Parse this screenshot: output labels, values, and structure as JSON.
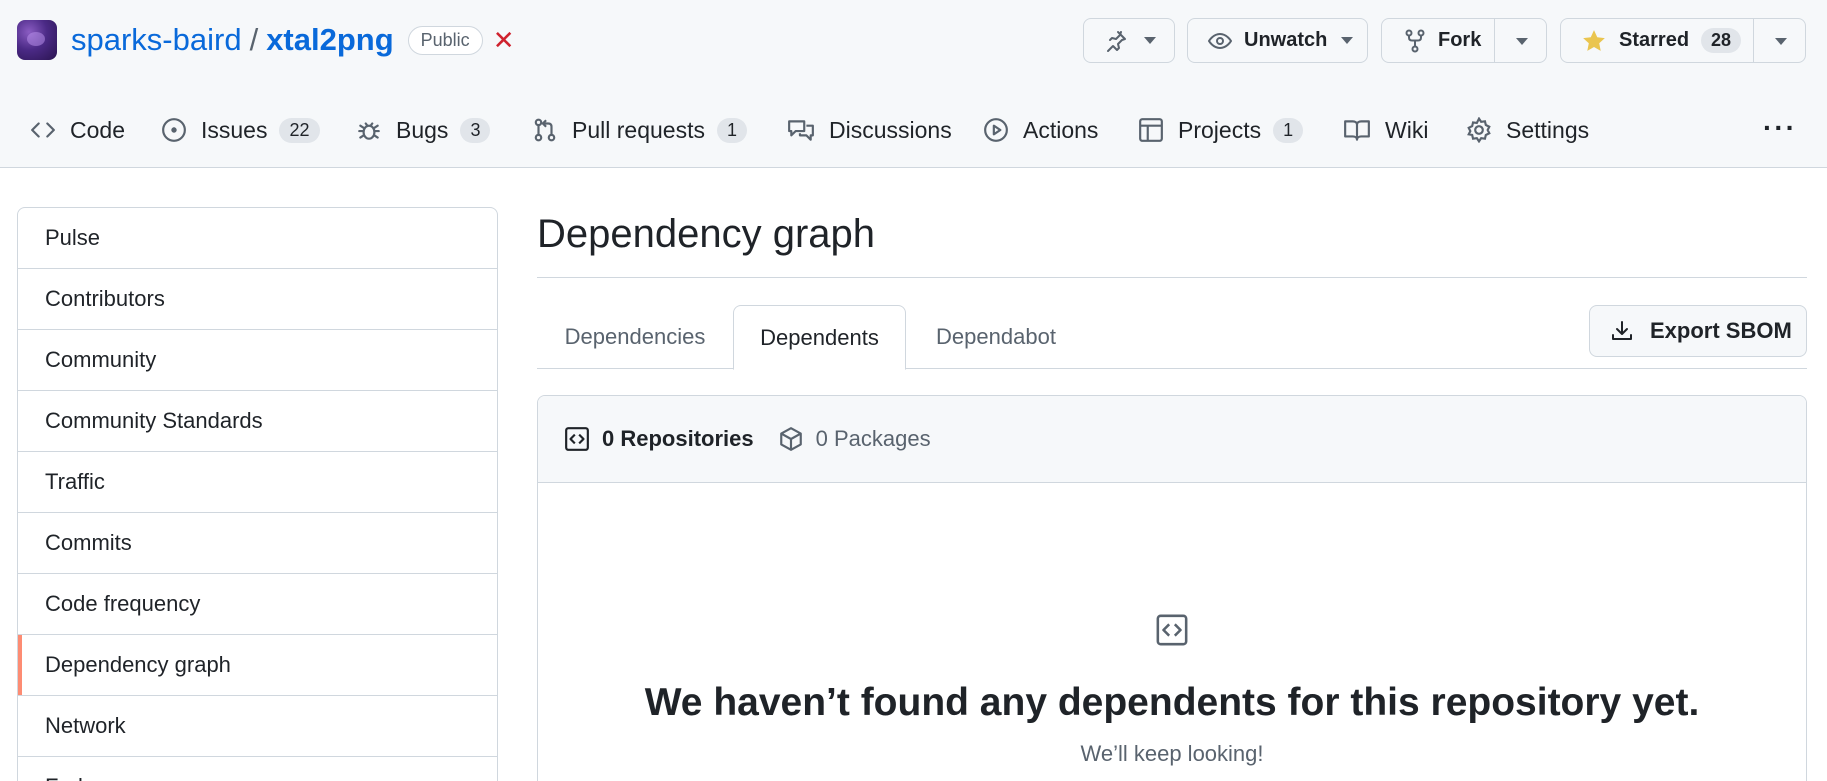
{
  "repo": {
    "owner": "sparks-baird",
    "separator": "/",
    "name": "xtal2png",
    "visibility": "Public",
    "status_mark": "✕"
  },
  "actions": {
    "pin_icon": "pin-icon",
    "watch_label": "Unwatch",
    "fork_label": "Fork",
    "star_label": "Starred",
    "star_count": "28"
  },
  "nav": {
    "items": [
      {
        "label": "Code",
        "icon": "code-icon"
      },
      {
        "label": "Issues",
        "icon": "issue-opened-icon",
        "count": "22"
      },
      {
        "label": "Bugs",
        "icon": "bug-icon",
        "count": "3"
      },
      {
        "label": "Pull requests",
        "icon": "git-pull-request-icon",
        "count": "1"
      },
      {
        "label": "Discussions",
        "icon": "comment-discussion-icon"
      },
      {
        "label": "Actions",
        "icon": "play-icon"
      },
      {
        "label": "Projects",
        "icon": "table-icon",
        "count": "1"
      },
      {
        "label": "Wiki",
        "icon": "book-icon"
      },
      {
        "label": "Settings",
        "icon": "gear-icon"
      }
    ],
    "more": "···"
  },
  "sidebar": {
    "items": [
      {
        "label": "Pulse"
      },
      {
        "label": "Contributors"
      },
      {
        "label": "Community"
      },
      {
        "label": "Community Standards"
      },
      {
        "label": "Traffic"
      },
      {
        "label": "Commits"
      },
      {
        "label": "Code frequency"
      },
      {
        "label": "Dependency graph",
        "active": true
      },
      {
        "label": "Network"
      },
      {
        "label": "Forks"
      }
    ]
  },
  "main": {
    "title": "Dependency graph",
    "tabs": [
      {
        "label": "Dependencies"
      },
      {
        "label": "Dependents",
        "active": true
      },
      {
        "label": "Dependabot"
      }
    ],
    "export_label": "Export SBOM",
    "box": {
      "repos_label": "0 Repositories",
      "packages_label": "0 Packages",
      "blank_title": "We haven’t found any dependents for this repository yet.",
      "blank_subtitle": "We’ll keep looking!"
    }
  },
  "colors": {
    "link": "#0969da",
    "active_accent": "#fd8c73",
    "star": "#eac54f",
    "danger": "#cf222e"
  }
}
